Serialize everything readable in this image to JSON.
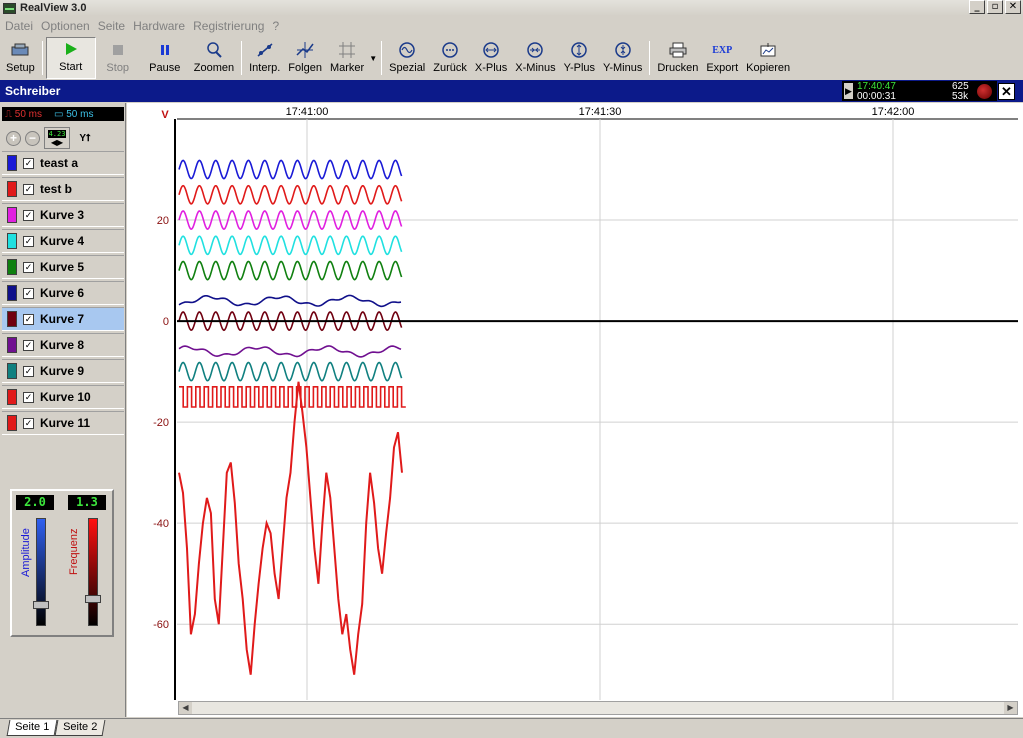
{
  "window": {
    "title": "RealView 3.0",
    "min": "_",
    "max": "▫",
    "close": "✕"
  },
  "menu": [
    "Datei",
    "Optionen",
    "Seite",
    "Hardware",
    "Registrierung",
    "?"
  ],
  "toolbar": {
    "setup": "Setup",
    "start": "Start",
    "stop": "Stop",
    "pause": "Pause",
    "zoomen": "Zoomen",
    "interp": "Interp.",
    "folgen": "Folgen",
    "marker": "Marker",
    "spezial": "Spezial",
    "zurueck": "Zurück",
    "xplus": "X-Plus",
    "xminus": "X-Minus",
    "yplus": "Y-Plus",
    "yminus": "Y-Minus",
    "drucken": "Drucken",
    "export": "Export",
    "kopieren": "Kopieren",
    "export_icon_text": "EXP"
  },
  "recorder": {
    "title": "Schreiber",
    "clock": "17:40:47",
    "elapsed": "00:00:31",
    "count1": "625",
    "count2": "53k",
    "close": "✕"
  },
  "left": {
    "timebase1": "50 ms",
    "timebase2": "50 ms",
    "lcd_tool": "4.23",
    "channels": [
      {
        "name": "teast a",
        "color": "#1a1ad6",
        "checked": true
      },
      {
        "name": "test b",
        "color": "#e01a1a",
        "checked": false
      },
      {
        "name": "Kurve 3",
        "color": "#e020e0",
        "checked": true
      },
      {
        "name": "Kurve 4",
        "color": "#20e0e0",
        "checked": true
      },
      {
        "name": "Kurve 5",
        "color": "#108010",
        "checked": true
      },
      {
        "name": "Kurve 6",
        "color": "#10108a",
        "checked": true
      },
      {
        "name": "Kurve 7",
        "color": "#700010",
        "checked": true,
        "selected": true
      },
      {
        "name": "Kurve 8",
        "color": "#701090",
        "checked": true
      },
      {
        "name": "Kurve 9",
        "color": "#108080",
        "checked": true
      },
      {
        "name": "Kurve 10",
        "color": "#e01a1a",
        "checked": true
      },
      {
        "name": "Kurve 11",
        "color": "#e01a1a",
        "checked": true
      }
    ],
    "amplitude_label": "Amplitude",
    "amplitude_value": "2.0",
    "frequenz_label": "Frequenz",
    "frequenz_value": "1.3"
  },
  "chart_data": {
    "type": "line",
    "ylabel": "V",
    "ylim": [
      -75,
      40
    ],
    "yticks": [
      20,
      0,
      -20,
      -40,
      -60
    ],
    "xticks": [
      "17:41:00",
      "17:41:30",
      "17:42:00"
    ],
    "series": [
      {
        "name": "teast a",
        "color": "#1a1ad6",
        "kind": "sine",
        "center": 30,
        "amp": 1.8
      },
      {
        "name": "test b",
        "color": "#e01a1a",
        "kind": "sine",
        "center": 25,
        "amp": 1.8
      },
      {
        "name": "Kurve 3",
        "color": "#e020e0",
        "kind": "sine",
        "center": 20,
        "amp": 1.8
      },
      {
        "name": "Kurve 4",
        "color": "#20e0e0",
        "kind": "sine",
        "center": 15,
        "amp": 1.8
      },
      {
        "name": "Kurve 5",
        "color": "#108010",
        "kind": "sine",
        "center": 10,
        "amp": 1.8
      },
      {
        "name": "Kurve 6",
        "color": "#10108a",
        "kind": "noise",
        "center": 4,
        "amp": 1.0
      },
      {
        "name": "Kurve 7",
        "color": "#700010",
        "kind": "sine",
        "center": 0,
        "amp": 1.8
      },
      {
        "name": "Kurve 8",
        "color": "#701090",
        "kind": "noise",
        "center": -6,
        "amp": 1.0
      },
      {
        "name": "Kurve 9",
        "color": "#108080",
        "kind": "sine",
        "center": -10,
        "amp": 1.8
      },
      {
        "name": "Kurve 10",
        "color": "#e01a1a",
        "kind": "square",
        "center": -15,
        "amp": 2.0
      },
      {
        "name": "Kurve 11",
        "color": "#e01a1a",
        "kind": "random",
        "values": [
          -30,
          -34,
          -45,
          -62,
          -58,
          -48,
          -40,
          -35,
          -38,
          -55,
          -60,
          -45,
          -30,
          -28,
          -36,
          -48,
          -55,
          -65,
          -70,
          -60,
          -52,
          -45,
          -40,
          -42,
          -50,
          -55,
          -45,
          -35,
          -30,
          -20,
          -12,
          -18,
          -25,
          -35,
          -45,
          -52,
          -40,
          -30,
          -35,
          -45,
          -55,
          -62,
          -58,
          -65,
          -70,
          -62,
          -56,
          -40,
          -30,
          -36,
          -45,
          -50,
          -42,
          -35,
          -25,
          -22,
          -30
        ]
      }
    ],
    "zero_line": 0
  },
  "pages": [
    "Seite 1",
    "Seite 2"
  ]
}
